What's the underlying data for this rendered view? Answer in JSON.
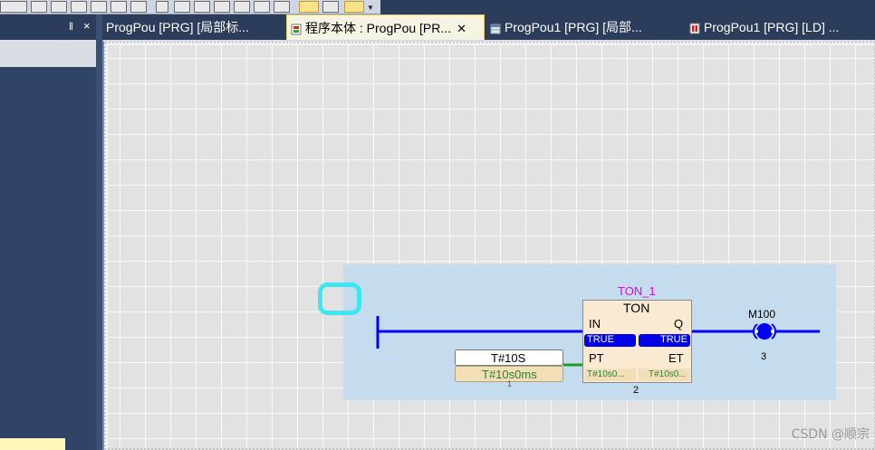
{
  "tabs": [
    {
      "label": "ProgPou [PRG] [局部标..."
    },
    {
      "label": "程序本体 : ProgPou [PR...",
      "active": true
    },
    {
      "label": "ProgPou1 [PRG] [局部..."
    },
    {
      "label": "ProgPou1 [PRG] [LD] ..."
    }
  ],
  "panel": {
    "pin_glyph": "‖",
    "close_glyph": "×"
  },
  "rung": {
    "instance_name": "TON_1",
    "fb_type": "TON",
    "in_label": "IN",
    "q_label": "Q",
    "pt_label": "PT",
    "et_label": "ET",
    "in_value": "TRUE",
    "q_value": "TRUE",
    "pt_value": "T#10s0...",
    "et_value": "T#10s0...",
    "const_text": "T#10S",
    "const_value": "T#10s0ms",
    "const_number": "1",
    "fb_number": "2",
    "coil_name": "M100",
    "coil_number": "3"
  },
  "colors": {
    "wire": "#0000ff",
    "highlight": "#c5dbee",
    "cursor": "#3ee6f2",
    "instance_name": "#e600e6"
  },
  "watermark": "CSDN @顺宗"
}
